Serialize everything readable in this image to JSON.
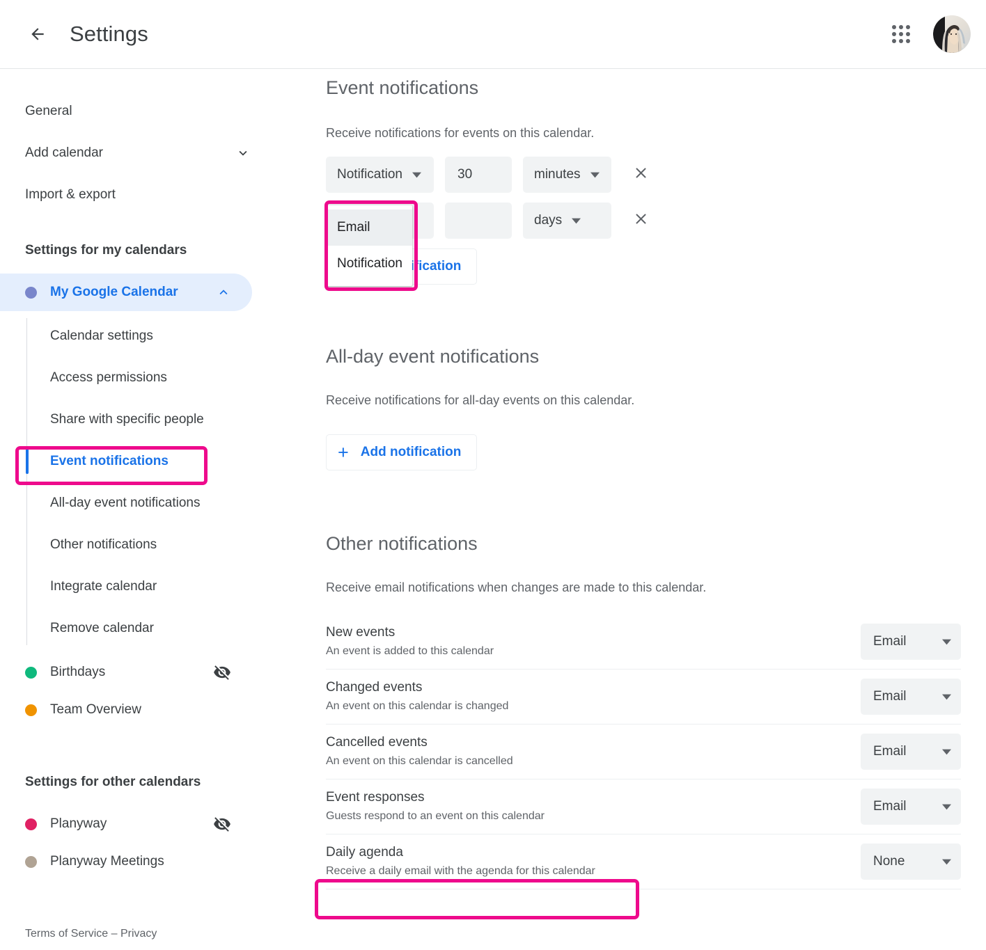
{
  "header": {
    "back_icon": "arrow-back-icon",
    "title": "Settings",
    "apps_icon": "apps-grid-icon",
    "avatar_label": "account-avatar"
  },
  "sidebar": {
    "top_items": [
      {
        "label": "General",
        "icon": null
      },
      {
        "label": "Add calendar",
        "icon": "chevron-down-icon"
      },
      {
        "label": "Import & export",
        "icon": null
      }
    ],
    "my_calendars_header": "Settings for my calendars",
    "my_calendars": [
      {
        "label": "My Google Calendar",
        "color": "#7986cb",
        "active": true,
        "expanded": true,
        "expand_icon": "chevron-up-icon",
        "sub_items": [
          {
            "label": "Calendar settings",
            "selected": false
          },
          {
            "label": "Access permissions",
            "selected": false
          },
          {
            "label": "Share with specific people",
            "selected": false
          },
          {
            "label": "Event notifications",
            "selected": true
          },
          {
            "label": "All-day event notifications",
            "selected": false
          },
          {
            "label": "Other notifications",
            "selected": false
          },
          {
            "label": "Integrate calendar",
            "selected": false
          },
          {
            "label": "Remove calendar",
            "selected": false
          }
        ]
      },
      {
        "label": "Birthdays",
        "color": "#0fb97d",
        "hidden_icon": "eye-off-icon"
      },
      {
        "label": "Team Overview",
        "color": "#f09300",
        "hidden_icon": null
      }
    ],
    "other_calendars_header": "Settings for other calendars",
    "other_calendars": [
      {
        "label": "Planyway",
        "color": "#e02163",
        "hidden_icon": "eye-off-icon"
      },
      {
        "label": "Planyway Meetings",
        "color": "#b0a394",
        "hidden_icon": null
      }
    ],
    "footer": {
      "terms": "Terms of Service",
      "separator": " – ",
      "privacy": "Privacy"
    }
  },
  "content": {
    "event_notifications": {
      "title": "Event notifications",
      "description": "Receive notifications for events on this calendar.",
      "rows": [
        {
          "type": "Notification",
          "amount": "30",
          "unit": "minutes",
          "remove_icon": "close-icon"
        },
        {
          "type": "",
          "amount": "",
          "unit": "days",
          "remove_icon": "close-icon"
        }
      ],
      "add_label": "Add notification",
      "add_icon": "plus-icon",
      "open_dropdown": {
        "options": [
          {
            "label": "Email",
            "hovered": true
          },
          {
            "label": "Notification",
            "hovered": false
          }
        ]
      }
    },
    "all_day_notifications": {
      "title": "All-day event notifications",
      "description": "Receive notifications for all-day events on this calendar.",
      "add_label": "Add notification",
      "add_icon": "plus-icon"
    },
    "other_notifications": {
      "title": "Other notifications",
      "description": "Receive email notifications when changes are made to this calendar.",
      "rows": [
        {
          "title": "New events",
          "sub": "An event is added to this calendar",
          "value": "Email"
        },
        {
          "title": "Changed events",
          "sub": "An event on this calendar is changed",
          "value": "Email"
        },
        {
          "title": "Cancelled events",
          "sub": "An event on this calendar is cancelled",
          "value": "Email"
        },
        {
          "title": "Event responses",
          "sub": "Guests respond to an event on this calendar",
          "value": "Email"
        },
        {
          "title": "Daily agenda",
          "sub": "Receive a daily email with the agenda for this calendar",
          "value": "None"
        }
      ]
    }
  },
  "annotations": {
    "highlight_color": "#ee0a8c",
    "boxes": [
      "dropdown-options",
      "sidebar-event-notifications",
      "daily-agenda-row"
    ]
  },
  "colors": {
    "accent_blue": "#1a73e8",
    "active_bg": "#e4eefd",
    "chip_bg": "#f1f3f4",
    "text_primary": "#3c4043",
    "text_secondary": "#5f6368"
  }
}
